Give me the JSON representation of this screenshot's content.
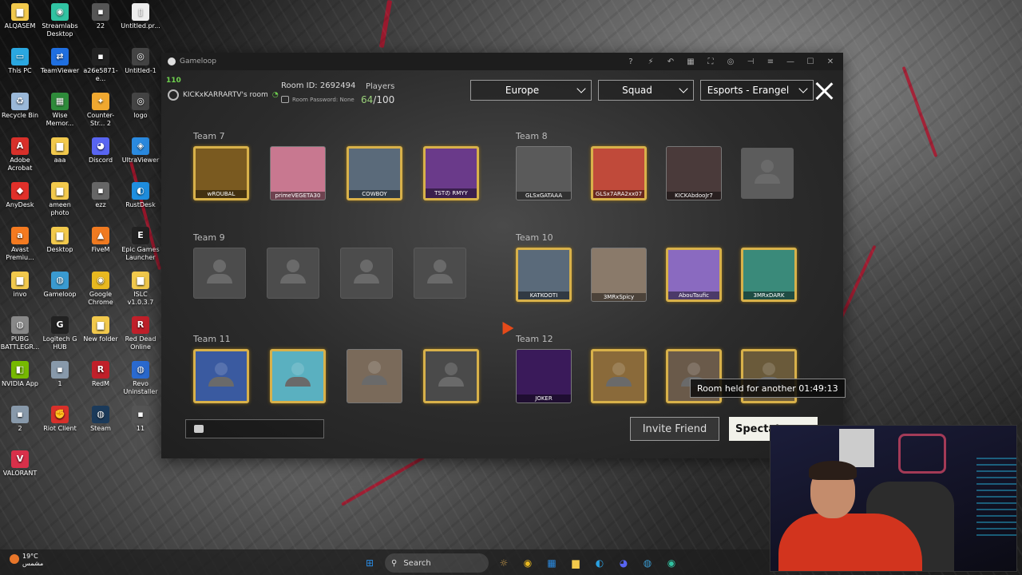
{
  "desktop": {
    "icons": [
      {
        "label": "ALQASEM",
        "glyph": "▆",
        "color": "#f2c94c"
      },
      {
        "label": "Streamlabs Desktop",
        "glyph": "◉",
        "color": "#31c3a2"
      },
      {
        "label": "22",
        "glyph": "▪",
        "color": "#555555"
      },
      {
        "label": "Untitled.pr...",
        "glyph": "▯",
        "color": "#eeeeee"
      },
      {
        "label": "This PC",
        "glyph": "▭",
        "color": "#2aa7e0"
      },
      {
        "label": "TeamViewer",
        "glyph": "⇄",
        "color": "#1f6fe0"
      },
      {
        "label": "a26e5871-e...",
        "glyph": "▪",
        "color": "#222222"
      },
      {
        "label": "Untitled-1",
        "glyph": "◎",
        "color": "#444444"
      },
      {
        "label": "Recycle Bin",
        "glyph": "♻",
        "color": "#9ab8d8"
      },
      {
        "label": "Wise Memor...",
        "glyph": "▦",
        "color": "#2e8b3a"
      },
      {
        "label": "Counter-Str... 2",
        "glyph": "✦",
        "color": "#f0a830"
      },
      {
        "label": "logo",
        "glyph": "◎",
        "color": "#444444"
      },
      {
        "label": "Adobe Acrobat",
        "glyph": "A",
        "color": "#d8302a"
      },
      {
        "label": "ааа",
        "glyph": "▆",
        "color": "#f2c94c"
      },
      {
        "label": "Discord",
        "glyph": "◕",
        "color": "#5865f2"
      },
      {
        "label": "UltraViewer",
        "glyph": "◈",
        "color": "#2a8ae0"
      },
      {
        "label": "AnyDesk",
        "glyph": "◆",
        "color": "#e0302a"
      },
      {
        "label": "ameen photo",
        "glyph": "▆",
        "color": "#f2c94c"
      },
      {
        "label": "ezz",
        "glyph": "▪",
        "color": "#666666"
      },
      {
        "label": "RustDesk",
        "glyph": "◐",
        "color": "#1f8fe0"
      },
      {
        "label": "Avast Premiu...",
        "glyph": "a",
        "color": "#f47a20"
      },
      {
        "label": "Desktop",
        "glyph": "▆",
        "color": "#f2c94c"
      },
      {
        "label": "FiveM",
        "glyph": "▲",
        "color": "#f07a20"
      },
      {
        "label": "Epic Games Launcher",
        "glyph": "E",
        "color": "#222222"
      },
      {
        "label": "invo",
        "glyph": "▆",
        "color": "#f2c94c"
      },
      {
        "label": "Gameloop",
        "glyph": "◍",
        "color": "#3a9ad0"
      },
      {
        "label": "Google Chrome",
        "glyph": "◉",
        "color": "#e8b820"
      },
      {
        "label": "ISLC v1.0.3.7",
        "glyph": "▆",
        "color": "#f2c94c"
      },
      {
        "label": "PUBG BATTLEGR...",
        "glyph": "◍",
        "color": "#888888"
      },
      {
        "label": "Logitech G HUB",
        "glyph": "G",
        "color": "#222222"
      },
      {
        "label": "New folder",
        "glyph": "▆",
        "color": "#f2c94c"
      },
      {
        "label": "Red Dead Online",
        "glyph": "R",
        "color": "#c0202a"
      },
      {
        "label": "NVIDIA App",
        "glyph": "◧",
        "color": "#76b900"
      },
      {
        "label": "1",
        "glyph": "▪",
        "color": "#8899aa"
      },
      {
        "label": "RedM",
        "glyph": "R",
        "color": "#c0202a"
      },
      {
        "label": "Revo Uninstaller",
        "glyph": "◍",
        "color": "#2a6ad0"
      },
      {
        "label": "2",
        "glyph": "▪",
        "color": "#8899aa"
      },
      {
        "label": "Riot Client",
        "glyph": "✊",
        "color": "#d8302a"
      },
      {
        "label": "Steam",
        "glyph": "◍",
        "color": "#1b3a5a"
      },
      {
        "label": "11",
        "glyph": "▪",
        "color": "#555555"
      },
      {
        "label": "VALORANT",
        "glyph": "V",
        "color": "#d8304a"
      }
    ]
  },
  "window": {
    "title": "Gameloop",
    "controls": [
      "?",
      "⚡",
      "↶",
      "▦",
      "⛶",
      "◎",
      "⊣",
      "≡",
      "—",
      "☐",
      "✕"
    ]
  },
  "room": {
    "fps": "110",
    "host": "KICKxKARRARTV's room",
    "room_id": "Room ID: 2692494",
    "password": "Room Password: None",
    "players_label": "Players",
    "players_current": "64",
    "players_max": "/100",
    "filters": {
      "region": "Europe",
      "mode": "Squad",
      "map": "Esports - Erangel"
    }
  },
  "teams": [
    {
      "label": "Team 7",
      "players": [
        {
          "name": "wROUBAL",
          "type": "frame",
          "bg": "#7a5a20"
        },
        {
          "name": "primeVEGETA30",
          "type": "plain",
          "bg": "#c87890"
        },
        {
          "name": "COWBOY",
          "type": "frame",
          "bg": "#5a6a7a"
        },
        {
          "name": "TSTの RMYY",
          "type": "frame",
          "bg": "#6a3a8a"
        }
      ]
    },
    {
      "label": "Team 8",
      "players": [
        {
          "name": "GLSxGATAAA",
          "type": "plain",
          "bg": "#5a5a5a"
        },
        {
          "name": "GLSx7ARA2xx07",
          "type": "frame",
          "bg": "#c04a3a"
        },
        {
          "name": "KICKAbdooJr7",
          "type": "plain",
          "bg": "#4a3a3a"
        },
        {
          "name": "",
          "type": "empty",
          "bg": "#5c5c5c"
        }
      ]
    },
    {
      "label": "Team 9",
      "players": [
        {
          "name": "",
          "type": "empty",
          "bg": "#4c4c4c"
        },
        {
          "name": "",
          "type": "empty",
          "bg": "#4c4c4c"
        },
        {
          "name": "",
          "type": "empty",
          "bg": "#4c4c4c"
        },
        {
          "name": "",
          "type": "empty",
          "bg": "#4c4c4c"
        }
      ]
    },
    {
      "label": "Team 10",
      "players": [
        {
          "name": "KATKOOTI",
          "type": "frame",
          "bg": "#5a6a7a"
        },
        {
          "name": "3MRxSpicy",
          "type": "plain",
          "bg": "#8a7a6a"
        },
        {
          "name": "AbouTaufic",
          "type": "frame",
          "bg": "#8a6ac0"
        },
        {
          "name": "3MRxDARK",
          "type": "frame",
          "bg": "#3a8a7a"
        }
      ]
    },
    {
      "label": "Team 11",
      "players": [
        {
          "name": "",
          "type": "frame",
          "bg": "#3a5aa0"
        },
        {
          "name": "",
          "type": "frame",
          "bg": "#5ab0c0"
        },
        {
          "name": "",
          "type": "plain",
          "bg": "#7a6a5a"
        },
        {
          "name": "",
          "type": "frame",
          "bg": "#4a4a4a"
        }
      ]
    },
    {
      "label": "Team 12",
      "players": [
        {
          "name": "JOKER",
          "type": "plain",
          "bg": "#3a1a5a"
        },
        {
          "name": "",
          "type": "frame",
          "bg": "#8a6a3a"
        },
        {
          "name": "",
          "type": "frame",
          "bg": "#6a5a4a"
        },
        {
          "name": "",
          "type": "frame",
          "bg": "#6a5a3a"
        }
      ]
    }
  ],
  "bottom": {
    "invite_label": "Invite Friend",
    "spectate_label": "Spectate",
    "tooltip": "Room held for another 01:49:13"
  },
  "taskbar": {
    "weather_temp": "19°C",
    "weather_desc": "مشمس",
    "search_label": "Search",
    "apps": [
      {
        "glyph": "⊞",
        "color": "#2a8ae0",
        "name": "start"
      },
      {
        "glyph": "☼",
        "color": "#c89a4a",
        "name": "widgets"
      },
      {
        "glyph": "◉",
        "color": "#e8b820",
        "name": "chrome"
      },
      {
        "glyph": "▦",
        "color": "#2a8ae0",
        "name": "store"
      },
      {
        "glyph": "▆",
        "color": "#f2c94c",
        "name": "explorer"
      },
      {
        "glyph": "◐",
        "color": "#2aa0e0",
        "name": "edge"
      },
      {
        "glyph": "◕",
        "color": "#5865f2",
        "name": "discord"
      },
      {
        "glyph": "◍",
        "color": "#3a9ad0",
        "name": "gameloop"
      },
      {
        "glyph": "◉",
        "color": "#31c3a2",
        "name": "streamlabs"
      }
    ]
  }
}
